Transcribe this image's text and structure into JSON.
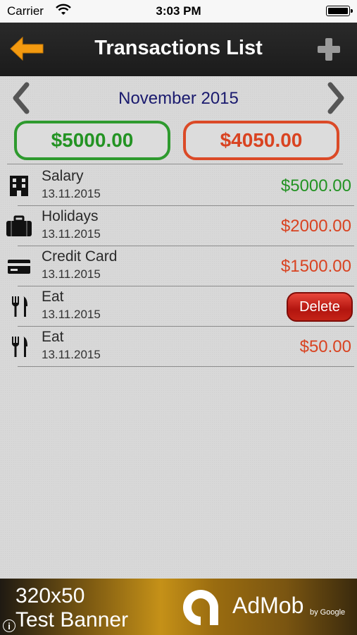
{
  "status": {
    "carrier": "Carrier",
    "time": "3:03 PM"
  },
  "nav": {
    "title": "Transactions List"
  },
  "month": {
    "label": "November 2015"
  },
  "summary": {
    "income": "$5000.00",
    "expense": "$4050.00"
  },
  "transactions": [
    {
      "name": "Salary",
      "date": "13.11.2015",
      "amount": "$5000.00",
      "icon": "building-icon",
      "type": "income"
    },
    {
      "name": "Holidays",
      "date": "13.11.2015",
      "amount": "$2000.00",
      "icon": "suitcase-icon",
      "type": "expense"
    },
    {
      "name": "Credit Card",
      "date": "13.11.2015",
      "amount": "$1500.00",
      "icon": "credit-card-icon",
      "type": "expense"
    },
    {
      "name": "Eat",
      "date": "13.11.2015",
      "amount": "",
      "icon": "cutlery-icon",
      "type": "expense",
      "delete_label": "Delete"
    },
    {
      "name": "Eat",
      "date": "13.11.2015",
      "amount": "$50.00",
      "icon": "cutlery-icon",
      "type": "expense"
    }
  ],
  "ad": {
    "size": "320x50",
    "label": "Test Banner",
    "brand": "AdMob",
    "by": "by Google",
    "info": "i"
  },
  "colors": {
    "income": "#239323",
    "expense": "#d94321",
    "back_arrow": "#f39a10",
    "month": "#1a1a6e",
    "delete": "#c42317"
  }
}
